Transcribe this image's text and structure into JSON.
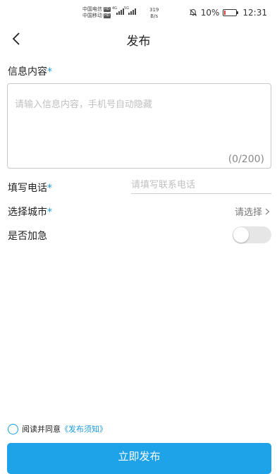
{
  "status_bar": {
    "carrier1": "中国电信",
    "carrier2": "中国移动",
    "hd_badge": "HD",
    "net_4g": "4G",
    "net_5g": "5G",
    "speed_value": "319",
    "speed_unit": "B/s",
    "battery": "10%",
    "time": "12:31",
    "battery_color": "#e53935"
  },
  "header": {
    "title": "发布"
  },
  "form": {
    "content_label": "信息内容",
    "content_placeholder": "请输入信息内容，手机号自动隐藏",
    "content_counter": "(0/200)",
    "phone_label": "填写电话",
    "phone_placeholder": "请填写联系电话",
    "city_label": "选择城市",
    "city_value": "请选择",
    "urgent_label": "是否加急",
    "urgent_on": false,
    "required_mark": "*"
  },
  "footer": {
    "agree_text": "阅读并同意",
    "agree_link": "《发布须知》",
    "submit_label": "立即发布"
  },
  "colors": {
    "accent": "#1ea2e8",
    "link": "#1a9ad8"
  }
}
